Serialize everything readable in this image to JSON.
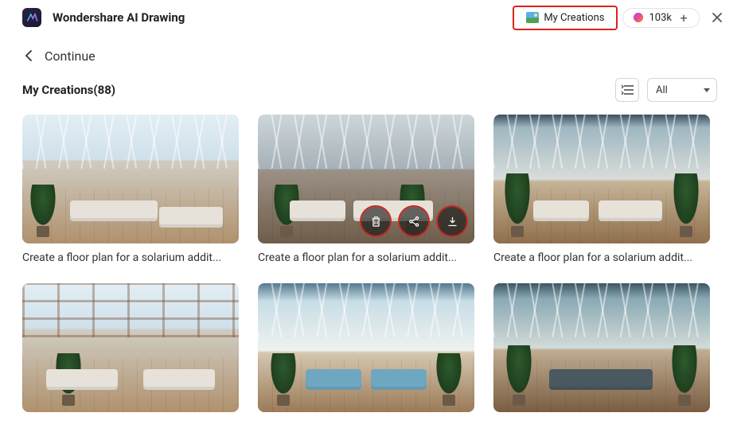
{
  "header": {
    "app_title": "Wondershare AI Drawing",
    "my_creations_label": "My Creations",
    "credits": "103k"
  },
  "nav": {
    "continue_label": "Continue"
  },
  "section": {
    "title_prefix": "My Creations",
    "count": "(88)",
    "filter_value": "All"
  },
  "cards": [
    {
      "caption": "Create a floor plan for a solarium addit..."
    },
    {
      "caption": "Create a floor plan for a solarium addit..."
    },
    {
      "caption": "Create a floor plan for a solarium addit..."
    },
    {
      "caption": ""
    },
    {
      "caption": ""
    },
    {
      "caption": ""
    }
  ],
  "icons": {
    "delete": "delete-icon",
    "share": "share-icon",
    "download": "download-icon",
    "sort": "sort-icon",
    "back": "chevron-left-icon",
    "plus": "plus-icon",
    "close": "close-icon",
    "picture": "picture-icon",
    "app": "app-logo-icon",
    "credits": "credits-icon",
    "dropdown": "chevron-down-icon"
  }
}
